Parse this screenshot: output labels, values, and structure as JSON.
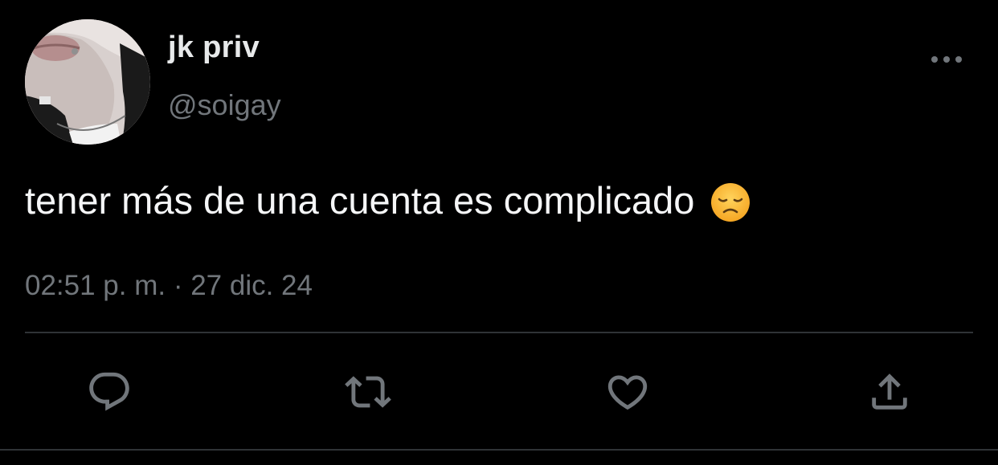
{
  "tweet": {
    "display_name": "jk priv",
    "handle": "@soigay",
    "text": "tener más de una cuenta es complicado",
    "emoji": "disappointed-face-emoji",
    "timestamp": "02:51 p. m. · 27 dic. 24"
  },
  "actions": {
    "reply": "reply-icon",
    "retweet": "retweet-icon",
    "like": "heart-icon",
    "share": "share-icon",
    "more": "more-options-icon"
  },
  "colors": {
    "background": "#000000",
    "primary_text": "#e7e9ea",
    "secondary_text": "#71767b",
    "divider": "#2f3336"
  }
}
